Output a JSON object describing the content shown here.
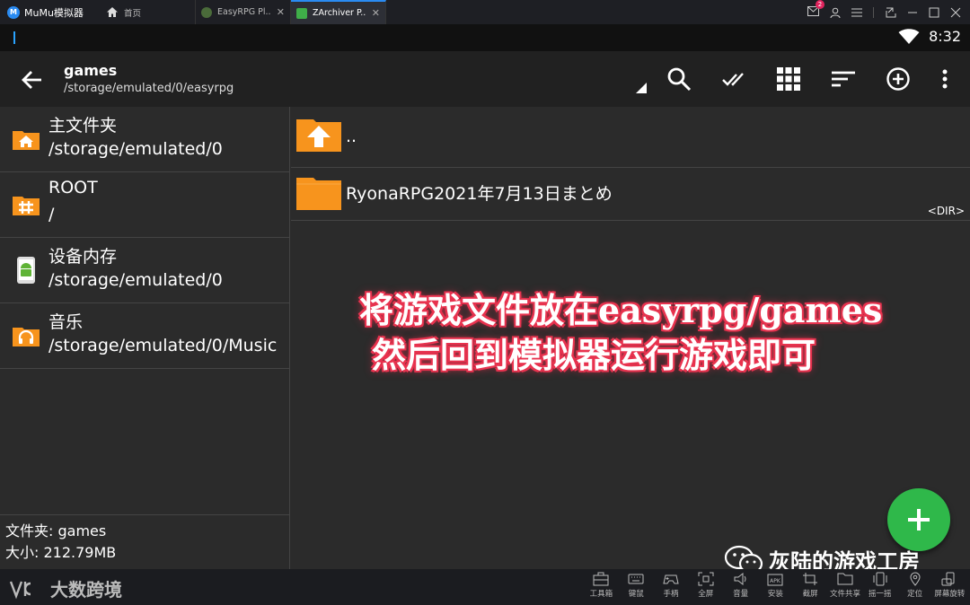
{
  "titlebar": {
    "app_name": "MuMu模拟器",
    "tabs": [
      {
        "label": "首页",
        "icon": "home-icon"
      },
      {
        "label": "EasyRPG Pl...",
        "icon": "easyrpg-app-icon",
        "close": "✕"
      },
      {
        "label": "ZArchiver P...",
        "icon": "zarchiver-app-icon",
        "close": "✕",
        "active": true
      }
    ],
    "notification_count": "2"
  },
  "statusbar": {
    "time": "8:32"
  },
  "appbar": {
    "title": "games",
    "path": "/storage/emulated/0/easyrpg"
  },
  "sidebar": {
    "items": [
      {
        "name": "主文件夹",
        "path": "/storage/emulated/0",
        "icon": "home-folder-icon"
      },
      {
        "name": "ROOT",
        "path": "/",
        "icon": "root-folder-icon"
      },
      {
        "name": "设备内存",
        "path": "/storage/emulated/0",
        "icon": "android-icon"
      },
      {
        "name": "音乐",
        "path": "/storage/emulated/0/Music",
        "icon": "music-folder-icon"
      }
    ],
    "info": {
      "folder": "文件夹: games",
      "size": "大小:   212.79MB"
    }
  },
  "files": [
    {
      "name": "..",
      "icon": "parent-folder-icon"
    },
    {
      "name": "RyonaRPG2021年7月13日まとめ",
      "icon": "folder-icon",
      "tag": "<DIR>"
    }
  ],
  "overlay": {
    "line1": "将游戏文件放在easyrpg/games",
    "line2": "然后回到模拟器运行游戏即可"
  },
  "watermark": "灰陆的游戏工房",
  "bottombar": {
    "logo": "大数跨境",
    "tools": [
      {
        "label": "工具箱",
        "icon": "toolbox-icon"
      },
      {
        "label": "键鼠",
        "icon": "keyboard-icon"
      },
      {
        "label": "手柄",
        "icon": "gamepad-icon"
      },
      {
        "label": "全屏",
        "icon": "fullscreen-icon"
      },
      {
        "label": "音量",
        "icon": "volume-icon"
      },
      {
        "label": "安装",
        "icon": "apk-install-icon"
      },
      {
        "label": "截屏",
        "icon": "screenshot-icon"
      },
      {
        "label": "文件共享",
        "icon": "folder-share-icon"
      },
      {
        "label": "摇一摇",
        "icon": "shake-icon"
      },
      {
        "label": "定位",
        "icon": "location-icon"
      },
      {
        "label": "屏幕旋转",
        "icon": "rotate-icon"
      }
    ]
  },
  "colors": {
    "folder_orange": "#f7941d",
    "fab_green": "#2fb84a",
    "caption_red": "#e8334f",
    "tab_accent": "#2a8bf2"
  }
}
